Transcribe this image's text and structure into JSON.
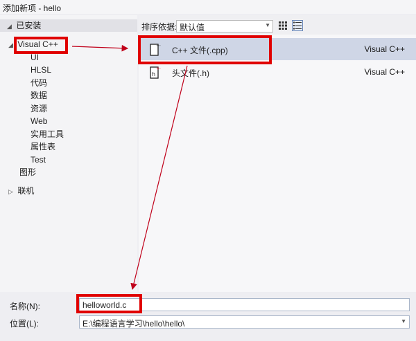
{
  "window": {
    "title": "添加新项 - hello"
  },
  "sidebar": {
    "installed_header": "已安装",
    "items": [
      {
        "label": "Visual C++",
        "expanded": true
      },
      {
        "label": "UI"
      },
      {
        "label": "HLSL"
      },
      {
        "label": "代码"
      },
      {
        "label": "数据"
      },
      {
        "label": "资源"
      },
      {
        "label": "Web"
      },
      {
        "label": "实用工具"
      },
      {
        "label": "属性表"
      },
      {
        "label": "Test"
      },
      {
        "label": "图形"
      },
      {
        "label": "联机",
        "expanded": false
      }
    ]
  },
  "toolbar": {
    "sort_label": "排序依据:",
    "sort_value": "默认值",
    "view_grid_icon": "grid-view-icon",
    "view_list_icon": "list-view-icon"
  },
  "templates": [
    {
      "name": "C++ 文件(.cpp)",
      "lang": "Visual C++",
      "icon": "cpp-file-icon",
      "selected": true
    },
    {
      "name": "头文件(.h)",
      "lang": "Visual C++",
      "icon": "header-file-icon",
      "selected": false
    }
  ],
  "form": {
    "name_label": "名称(N):",
    "name_value": "helloworld.c",
    "location_label": "位置(L):",
    "location_value": "E:\\编程语言学习\\hello\\hello\\"
  },
  "colors": {
    "highlight": "#e00000",
    "selected_row": "#cfd6e6",
    "arrow": "#c0001a"
  }
}
